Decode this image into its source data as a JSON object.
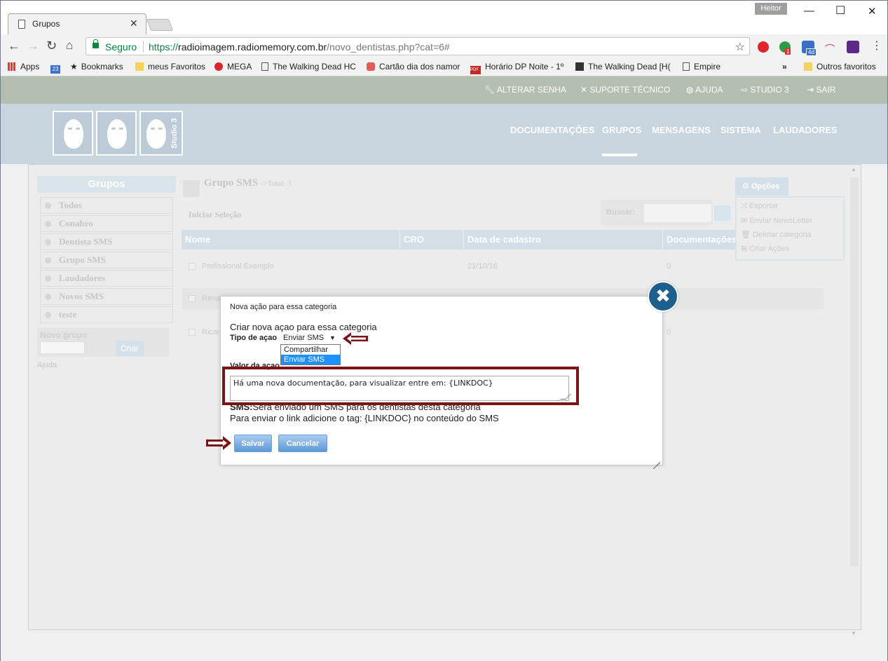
{
  "browser": {
    "tab_title": "Grupos",
    "user": "Heitor",
    "secure_label": "Seguro",
    "url_proto": "https://",
    "url_host": "radioimagem.radiomemory.com.br",
    "url_path": "/novo_dentistas.php?cat=6#",
    "bookmarks": [
      "Apps",
      "Bookmarks",
      "meus Favoritos",
      "MEGA",
      "The Walking Dead HC",
      "Cartão dia dos namor",
      "Horário DP Noite - 1º",
      "The Walking Dead [H(",
      "Empire"
    ],
    "overflow": "»",
    "other_bookmarks": "Outros favoritos",
    "calendar_num": "23",
    "pdf_label": "PDF",
    "ext_badges": [
      "1",
      "4d"
    ]
  },
  "topbar": {
    "links": [
      "ALTERAR SENHA",
      "SUPORTE TÉCNICO",
      "AJUDA",
      "STUDIO 3",
      "SAIR"
    ]
  },
  "header": {
    "logo_text": "Studio 3",
    "nav": [
      "DOCUMENTAÇÕES",
      "GRUPOS",
      "MENSAGENS",
      "SISTEMA",
      "LAUDADORES"
    ]
  },
  "sidebar": {
    "title": "Grupos",
    "groups": [
      "Todos",
      "Conabro",
      "Dentista SMS",
      "Grupo SMS",
      "Laudadores",
      "Novos SMS",
      "teste"
    ],
    "new_group_label": "Novo grupo",
    "create_button": "Criar",
    "help": "Ajuda"
  },
  "main": {
    "group_title": "Grupo SMS",
    "total": "->Total: 3",
    "select_label": "Iniciar Seleção",
    "search_label": "Buscar:",
    "columns": [
      "Nome",
      "CRO",
      "Data de cadastro",
      "Documentações"
    ],
    "rows": [
      {
        "name": "Profissional Exemplo",
        "cro": "",
        "date": "21/10/16",
        "docs": "0"
      },
      {
        "name": "Rena",
        "cro": "",
        "date": "",
        "docs": ""
      },
      {
        "name": "Ricar",
        "cro": "",
        "date": "",
        "docs": "0"
      }
    ],
    "options_label": "Opções",
    "options": [
      "Exportar",
      "Enviar NewsLetter",
      "Deletar categoria",
      "Criar Ações"
    ]
  },
  "modal": {
    "title": "Nova ação para essa categoria",
    "subtitle": "Criar nova açao para essa categoria",
    "type_label": "Tipo de açao",
    "type_selected": "Enviar SMS",
    "type_options": [
      "Compartilhar",
      "Enviar SMS"
    ],
    "value_label": "Valor da açao",
    "value": "Há uma nova documentação, para visualizar entre em: {LINKDOC}",
    "note_bold": "SMS:",
    "note1": "Será enviado um SMS para os dentistas desta categoria",
    "note2": "Para enviar o link adicione o tag: {LINKDOC} no conteúdo do SMS",
    "save": "Salvar",
    "cancel": "Cancelar"
  },
  "colors": {
    "accent": "#1d5f8c",
    "annotation": "#7b1416",
    "button": "#5e98d6"
  }
}
